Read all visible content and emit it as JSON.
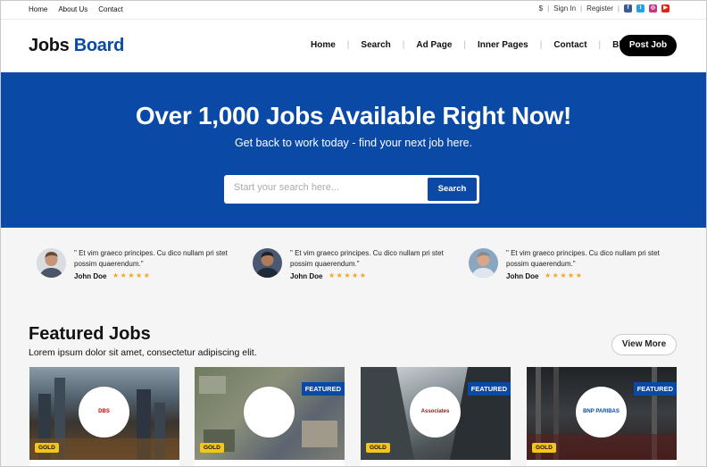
{
  "topbar": {
    "links": [
      "Home",
      "About Us",
      "Contact"
    ],
    "currency": "$",
    "signin": "Sign In",
    "register": "Register",
    "social_icons": [
      "facebook-icon",
      "twitter-icon",
      "instagram-icon",
      "youtube-icon"
    ]
  },
  "header": {
    "logo_part1": "Jobs",
    "logo_part2": "Board",
    "nav": [
      "Home",
      "Search",
      "Ad Page",
      "Inner Pages",
      "Contact",
      "Blog"
    ],
    "cta": "Post Job"
  },
  "hero": {
    "title": "Over 1,000 Jobs Available Right Now!",
    "subtitle": "Get back to work today - find your next job here.",
    "search_placeholder": "Start your search here...",
    "search_button": "Search"
  },
  "testimonials": [
    {
      "quote": "\" Et vim graeco principes. Cu dico nullam pri stet possim quaerendum.\"",
      "name": "John Doe",
      "stars": "★★★★★"
    },
    {
      "quote": "\" Et vim graeco principes. Cu dico nullam pri stet possim quaerendum.\"",
      "name": "John Doe",
      "stars": "★★★★★"
    },
    {
      "quote": "\" Et vim graeco principes. Cu dico nullam pri stet possim quaerendum.\"",
      "name": "John Doe",
      "stars": "★★★★★"
    }
  ],
  "featured": {
    "title": "Featured Jobs",
    "subtitle": "Lorem ipsum dolor sit amet, consectetur adipiscing elit.",
    "view_more": "View More",
    "cards": [
      {
        "company": "DBS",
        "gold": "GOLD",
        "featured": ""
      },
      {
        "company": "",
        "gold": "GOLD",
        "featured": "FEATURED"
      },
      {
        "company": "Associates",
        "gold": "GOLD",
        "featured": "FEATURED"
      },
      {
        "company": "BNP PARIBAS",
        "gold": "GOLD",
        "featured": "FEATURED"
      }
    ]
  },
  "colors": {
    "brand": "#0a4aa6",
    "gold": "#f5c518",
    "star": "#f5a623"
  }
}
